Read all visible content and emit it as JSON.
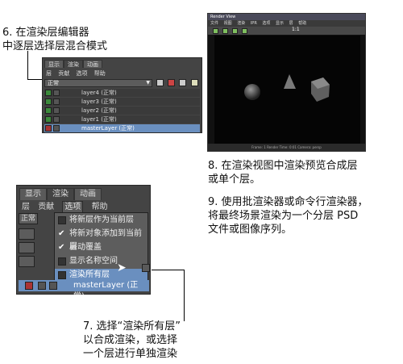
{
  "captions": {
    "step6": [
      "6. 在渲染层编辑器",
      "中逐层选择层混合模式"
    ],
    "step8": [
      "8. 在渲染视图中渲染预览合成层",
      "或单个层。"
    ],
    "step9": [
      "9. 使用批渲染器或命令行渲染器，",
      "将最终场景渲染为一个分层 PSD",
      "文件或图像序列。"
    ],
    "step7": [
      "7. 选择“渲染所有层”",
      "以合成渲染，或选择",
      "一个层进行单独渲染"
    ]
  },
  "layer_editor": {
    "tabs": [
      "显示",
      "渲染",
      "动画"
    ],
    "active_tab": "渲染",
    "menu": [
      "层",
      "贡献",
      "选项",
      "帮助"
    ],
    "blend_mode": "正常",
    "layers": [
      "layer4 (正常)",
      "layer3 (正常)",
      "layer2 (正常)",
      "layer1 (正常)",
      "masterLayer (正常)"
    ],
    "selected_layer": "masterLayer (正常)"
  },
  "render_view": {
    "title": "Render View",
    "menu": [
      "文件",
      "视图",
      "渲染",
      "IPR",
      "选项",
      "显示",
      "层",
      "帮助"
    ],
    "ratio": "1:1",
    "status": "Frame: 1   Render Time: 0:01   Camera: persp"
  },
  "options_panel": {
    "tabs": [
      "显示",
      "渲染",
      "动画"
    ],
    "active_tab": "渲染",
    "menu": [
      "层",
      "贡献",
      "选项",
      "帮助"
    ],
    "open_menu": "选项",
    "left_stub_label": "正常",
    "dropdown": [
      {
        "label": "将新层作为当前层",
        "checked": false
      },
      {
        "label": "将新对象添加到当前层",
        "checked": true
      },
      {
        "label": "自动覆盖",
        "checked": true
      },
      {
        "label": "显示名称空间",
        "checked": false
      },
      {
        "label": "渲染所有层",
        "checked": false
      }
    ],
    "highlighted_item": "渲染所有层",
    "bottom_layer": "masterLayer (正常)"
  }
}
